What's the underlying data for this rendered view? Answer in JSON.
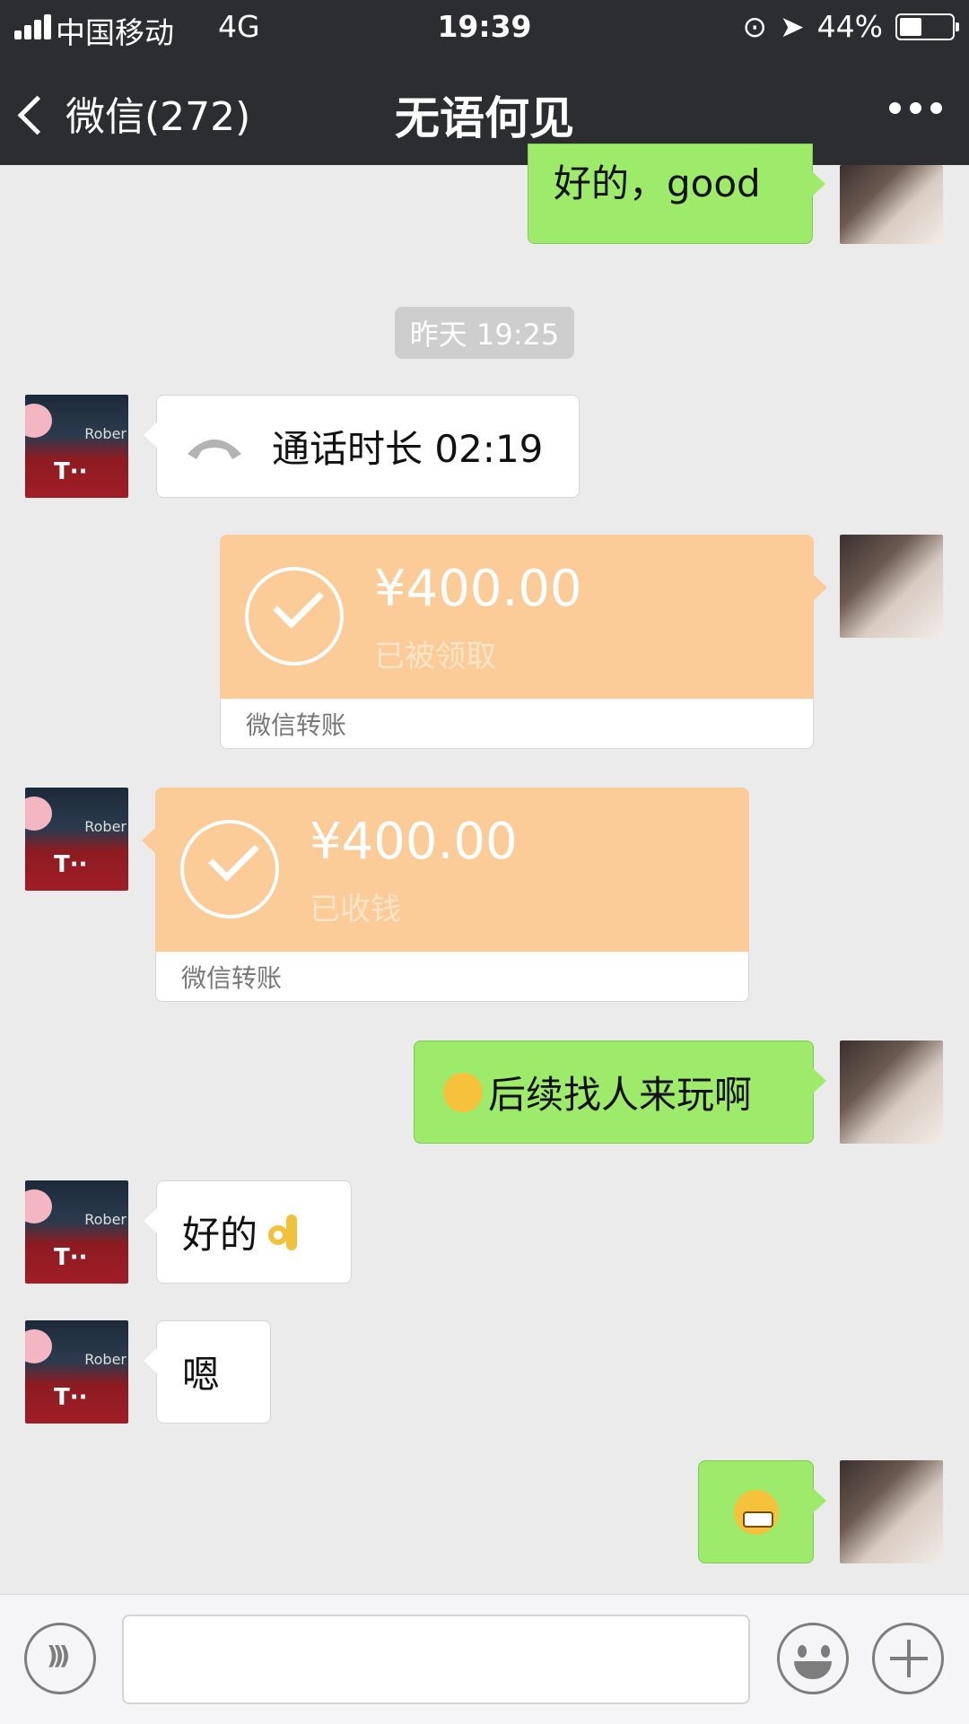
{
  "status_bar": {
    "carrier": "中国移动",
    "network": "4G",
    "time": "19:39",
    "battery": "44%",
    "icons": [
      "signal-icon",
      "orientation-lock-icon",
      "location-icon",
      "battery-icon"
    ]
  },
  "nav": {
    "back_label": "微信(272)",
    "title": "无语何见",
    "more_icon": "more-icon"
  },
  "messages": {
    "m1_text": "好的，good",
    "timestamp": "昨天 19:25",
    "call_text": "通话时长 02:19",
    "transfer1": {
      "amount": "¥400.00",
      "status": "已被领取",
      "footer": "微信转账"
    },
    "transfer2": {
      "amount": "¥400.00",
      "status": "已收钱",
      "footer": "微信转账"
    },
    "m2_text": "后续找人来玩啊",
    "m3_text": "好的",
    "m4_text": "嗯"
  },
  "input_bar": {
    "voice_icon": "voice-icon",
    "emoji_icon": "emoji-icon",
    "plus_icon": "plus-icon",
    "placeholder": ""
  },
  "colors": {
    "header_bg": "#2b2d31",
    "chat_bg": "#ebebeb",
    "sent_bubble": "#9eea6a",
    "transfer_bg": "#fbcb98"
  }
}
